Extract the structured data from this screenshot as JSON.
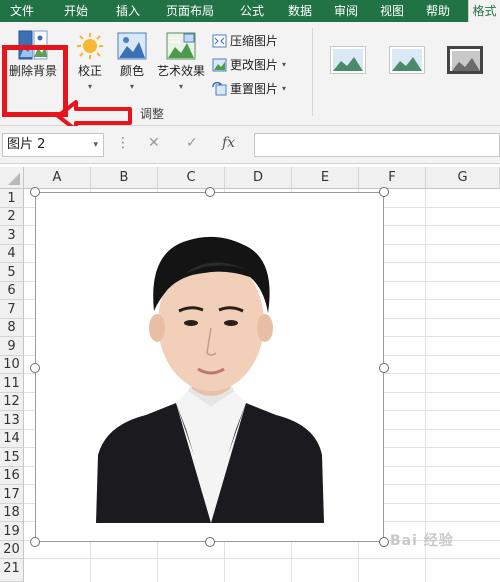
{
  "ribbon_tabs": [
    "文件",
    "开始",
    "插入",
    "页面布局",
    "公式",
    "数据",
    "审阅",
    "视图",
    "帮助",
    "格式"
  ],
  "ribbon": {
    "remove_bg_label": "删除背景",
    "corrections_label": "校正",
    "color_label": "颜色",
    "artistic_label": "艺术效果",
    "compress_label": "压缩图片",
    "change_label": "更改图片",
    "reset_label": "重置图片",
    "adjust_group_label": "调整"
  },
  "formula_bar": {
    "name_box": "图片 2",
    "cancel_symbol": "✕",
    "enter_symbol": "✓",
    "fx_symbol": "fx",
    "value": ""
  },
  "columns": [
    "A",
    "B",
    "C",
    "D",
    "E",
    "F",
    "G"
  ],
  "rows": [
    "1",
    "2",
    "3",
    "4",
    "5",
    "6",
    "7",
    "8",
    "9",
    "10",
    "11",
    "12",
    "13",
    "14",
    "15",
    "16",
    "17",
    "18",
    "19",
    "20",
    "21"
  ],
  "annotations": {
    "highlight_color": "#e8141b",
    "arrow_color": "#e8141b"
  },
  "theme": {
    "tab_bar_color": "#217346"
  },
  "watermark": "Bai 经验"
}
